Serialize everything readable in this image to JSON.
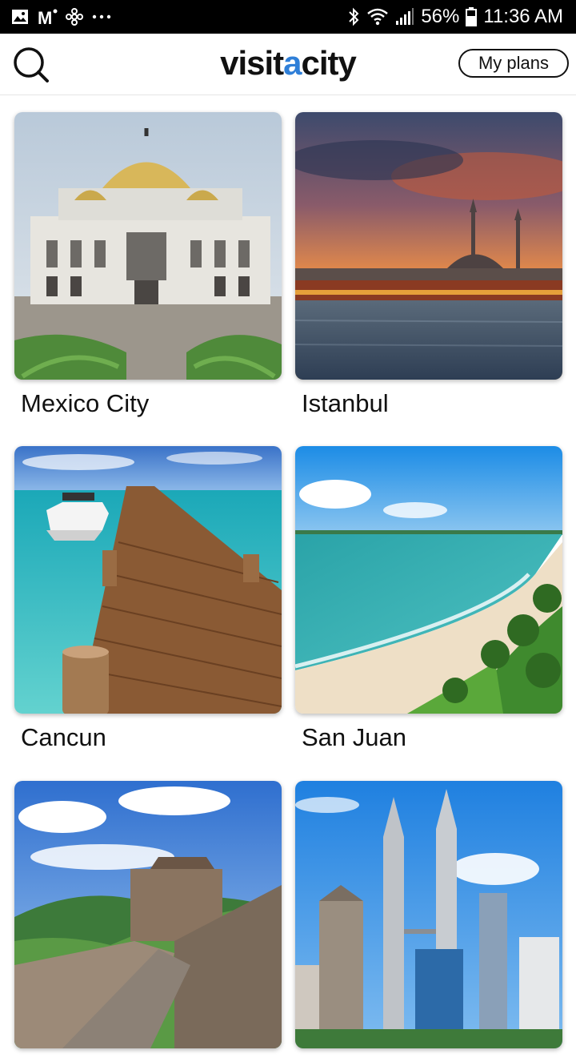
{
  "status_bar": {
    "left_icons": [
      "image-icon",
      "gmail-icon",
      "fan-icon",
      "more-dots-icon"
    ],
    "right_icons": [
      "bluetooth-icon",
      "wifi-icon",
      "signal-icon",
      "battery-icon"
    ],
    "battery": "56%",
    "time": "11:36 AM"
  },
  "header": {
    "logo_prefix": "visit",
    "logo_accent": "a",
    "logo_suffix": "city",
    "accent_color": "#2f7fd8",
    "my_plans_label": "My plans",
    "search_icon": "search-icon"
  },
  "cities": [
    {
      "name": "Mexico City"
    },
    {
      "name": "Istanbul"
    },
    {
      "name": "Cancun"
    },
    {
      "name": "San Juan"
    },
    {
      "name": ""
    },
    {
      "name": ""
    }
  ]
}
